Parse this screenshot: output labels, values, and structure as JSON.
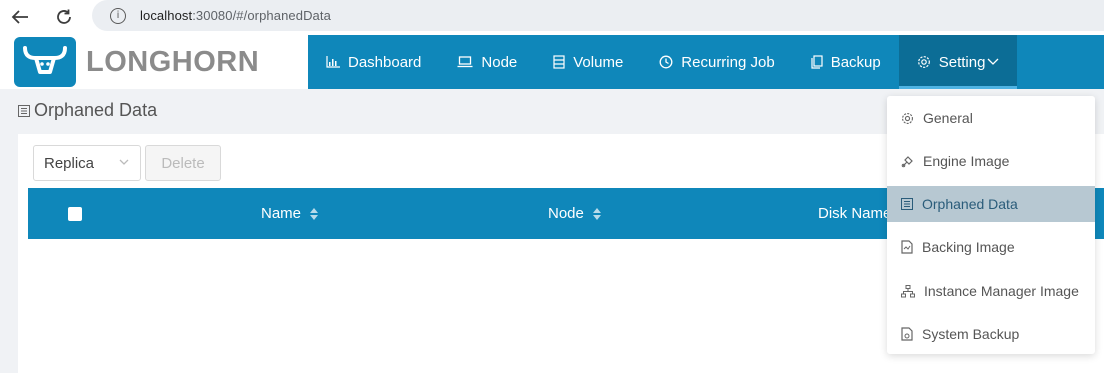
{
  "browser": {
    "url_host": "localhost",
    "url_rest": ":30080/#/orphanedData"
  },
  "app": {
    "logo_text": "LONGHORN",
    "nav": [
      {
        "label": "Dashboard",
        "icon": "bar-chart-icon"
      },
      {
        "label": "Node",
        "icon": "laptop-icon"
      },
      {
        "label": "Volume",
        "icon": "database-icon"
      },
      {
        "label": "Recurring Job",
        "icon": "clock-icon"
      },
      {
        "label": "Backup",
        "icon": "copy-icon"
      },
      {
        "label": "Setting",
        "icon": "gear-icon",
        "active": true
      }
    ]
  },
  "page": {
    "title": "Orphaned Data",
    "filter_value": "Replica",
    "delete_label": "Delete",
    "columns": [
      "Name",
      "Node",
      "Disk Name"
    ]
  },
  "settings_menu": {
    "items": [
      {
        "label": "General",
        "icon": "gear-icon"
      },
      {
        "label": "Engine Image",
        "icon": "engine-icon"
      },
      {
        "label": "Orphaned Data",
        "icon": "list-icon",
        "selected": true
      },
      {
        "label": "Backing Image",
        "icon": "file-icon"
      },
      {
        "label": "Instance Manager Image",
        "icon": "tree-icon"
      },
      {
        "label": "System Backup",
        "icon": "backup-file-icon"
      }
    ]
  },
  "colors": {
    "brand": "#0f87ba",
    "active_nav": "#0c6d96",
    "selected_menu": "#b7c8d2"
  }
}
